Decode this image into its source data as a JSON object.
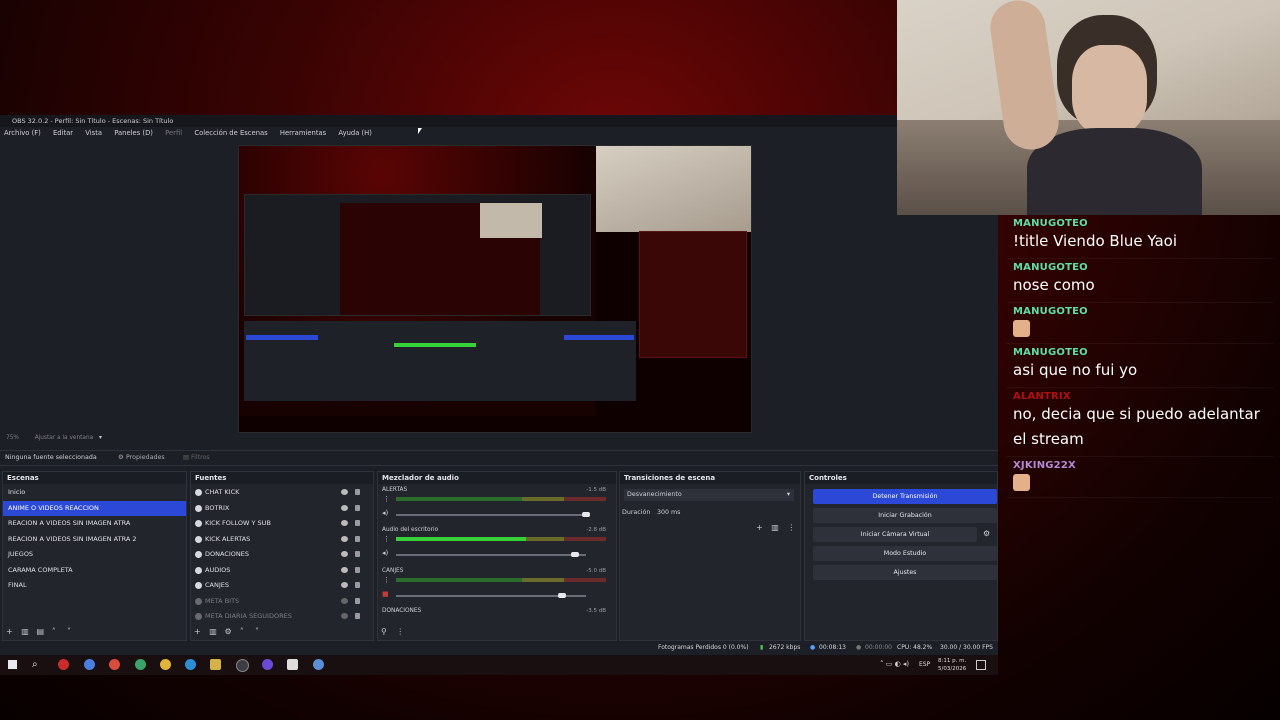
{
  "obs": {
    "title": "OBS 32.0.2 - Perfil: Sin Título - Escenas: Sin Título",
    "menu": [
      "Archivo (F)",
      "Editar",
      "Vista",
      "Paneles (D)",
      "Perfil",
      "Colección de Escenas",
      "Herramientas",
      "Ayuda (H)"
    ],
    "zoom": "75%",
    "zoom_mode": "Ajustar a la ventana",
    "no_source": "Ninguna fuente seleccionada",
    "properties": "Propiedades",
    "filters": "Filtros",
    "scenes": {
      "title": "Escenas",
      "items": [
        "Inicio",
        "ANIME O VIDEOS REACCION",
        "REACION A VIDEOS SIN IMAGEN ATRA",
        "REACION A VIDEOS SIN IMAGEN ATRA 2",
        "JUEGOS",
        "CARAMA COMPLETA",
        "FINAL"
      ]
    },
    "sources": {
      "title": "Fuentes",
      "items": [
        "CHAT KICK",
        "BOTRIX",
        "KICK FOLLOW Y SUB",
        "KICK ALERTAS",
        "DONACIONES",
        "AUDIOS",
        "CANJES",
        "META BITS",
        "META DIARIA SEGUIDORES"
      ]
    },
    "mixer": {
      "title": "Mezclador de audio",
      "channels": [
        {
          "name": "ALERTAS",
          "db": "-1.5 dB",
          "level": 0.0,
          "volume": 0.98
        },
        {
          "name": "Audio del escritorio",
          "db": "-2.8 dB",
          "level": 0.62,
          "volume": 0.92
        },
        {
          "name": "CANJES",
          "db": "-5.0 dB",
          "level": 0.0,
          "volume": 0.85
        },
        {
          "name": "DONACIONES",
          "db": "-3.5 dB",
          "level": 0.0,
          "volume": 0.9
        }
      ]
    },
    "transitions": {
      "title": "Transiciones de escena",
      "selected": "Desvanecimiento",
      "duration_label": "Duración",
      "duration_value": "300 ms"
    },
    "controls": {
      "title": "Controles",
      "buttons": [
        "Detener Transmisión",
        "Iniciar Grabación",
        "Iniciar Cámara Virtual",
        "Modo Estudio",
        "Ajustes"
      ]
    },
    "status": {
      "dropped": "Fotogramas Perdidos 0 (0.0%)",
      "bitrate": "2672 kbps",
      "stream_time": "00:08:13",
      "rec_time": "00:00:00",
      "cpu": "CPU: 48.2%",
      "fps": "30.00 / 30.00 FPS"
    }
  },
  "taskbar": {
    "lang": "ESP",
    "time": "8:11 p. m.",
    "date": "5/03/2026"
  },
  "chat": {
    "messages": [
      {
        "user": "MANUGOTEO",
        "text": "!title Viendo Blue Yaoi",
        "color": "#5fdfa3"
      },
      {
        "user": "MANUGOTEO",
        "text": "nose como",
        "color": "#5fdfa3"
      },
      {
        "user": "MANUGOTEO",
        "text": "",
        "emote": true,
        "color": "#5fdfa3"
      },
      {
        "user": "MANUGOTEO",
        "text": "asi que no fui yo",
        "color": "#5fdfa3"
      },
      {
        "user": "ALANTRIX",
        "text": "no, decia que si puedo adelantar el stream",
        "color": "#b01010"
      },
      {
        "user": "XJKING22X",
        "text": "",
        "emote": true,
        "color": "#b58ad8"
      }
    ]
  }
}
